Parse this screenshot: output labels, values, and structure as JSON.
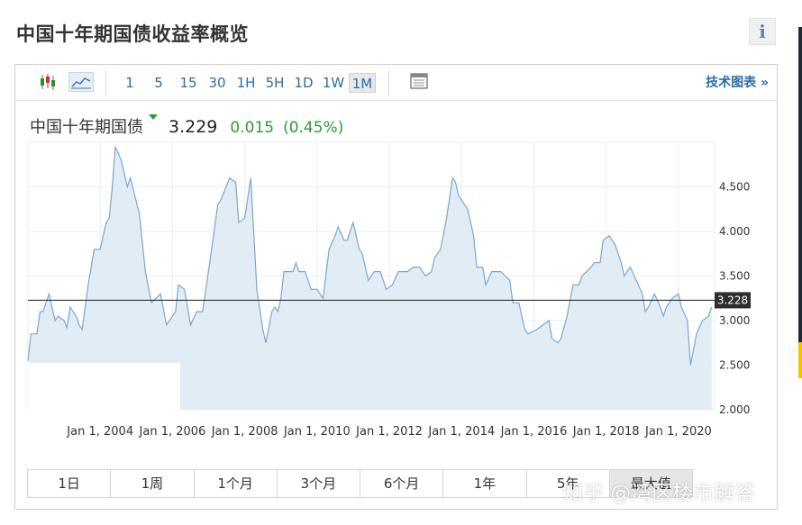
{
  "page": {
    "title": "中国十年期国债收益率概览",
    "info_icon": "i"
  },
  "toolbar": {
    "icons": [
      "candlestick-icon",
      "line-chart-icon",
      "table-icon"
    ],
    "intervals": [
      "1",
      "5",
      "15",
      "30",
      "1H",
      "5H",
      "1D",
      "1W",
      "1M"
    ],
    "active_interval": "1M",
    "tech_chart_label": "技术图表 »"
  },
  "quote": {
    "name": "中国十年期国债",
    "price": "3.229",
    "change": "0.015",
    "change_pct": "(0.45%)"
  },
  "colors": {
    "line": "#7aa7cf",
    "fill": "#e2ecf4",
    "positive": "#2e9a2e",
    "link": "#2c6cb0",
    "current_line": "#333333"
  },
  "chart_data": {
    "type": "area",
    "x_tick_labels": [
      "Jan 1, 2004",
      "Jan 1, 2006",
      "Jan 1, 2008",
      "Jan 1, 2010",
      "Jan 1, 2012",
      "Jan 1, 2014",
      "Jan 1, 2016",
      "Jan 1, 2018",
      "Jan 1, 2020"
    ],
    "y_tick_labels": [
      "2.000",
      "2.500",
      "3.000",
      "3.500",
      "4.000",
      "4.500"
    ],
    "ylim": [
      2.0,
      5.0
    ],
    "xlim": [
      "2002-01",
      "2020-12"
    ],
    "current_value_label": "3.228",
    "current_value": 3.228,
    "series": [
      {
        "dates": [
          "2002-01",
          "2002-02",
          "2002-04",
          "2002-05",
          "2002-06",
          "2002-08",
          "2002-10",
          "2002-11",
          "2003-01",
          "2003-02",
          "2003-03",
          "2003-05",
          "2003-06",
          "2003-07",
          "2003-09",
          "2003-11",
          "2004-01",
          "2004-03",
          "2004-04",
          "2004-05",
          "2004-06",
          "2004-08",
          "2004-10",
          "2004-11",
          "2005-02",
          "2005-04",
          "2005-06",
          "2005-09",
          "2005-11",
          "2006-02",
          "2006-03",
          "2006-05",
          "2006-07",
          "2006-09",
          "2006-11",
          "2007-02",
          "2007-04",
          "2007-05",
          "2007-08",
          "2007-10",
          "2007-11",
          "2008-01",
          "2008-03",
          "2008-05",
          "2008-07",
          "2008-08",
          "2008-10",
          "2008-11",
          "2008-12",
          "2009-01",
          "2009-02",
          "2009-05",
          "2009-06",
          "2009-07",
          "2009-09",
          "2009-11",
          "2010-01",
          "2010-03",
          "2010-05",
          "2010-07",
          "2010-08",
          "2010-10",
          "2010-11",
          "2011-01",
          "2011-03",
          "2011-04",
          "2011-06",
          "2011-08",
          "2011-09",
          "2011-10",
          "2011-12",
          "2012-02",
          "2012-04",
          "2012-07",
          "2012-09",
          "2012-11",
          "2013-01",
          "2013-03",
          "2013-04",
          "2013-06",
          "2013-08",
          "2013-10",
          "2013-11",
          "2013-12",
          "2014-02",
          "2014-03",
          "2014-05",
          "2014-06",
          "2014-08",
          "2014-09",
          "2014-11",
          "2015-01",
          "2015-02",
          "2015-05",
          "2015-06",
          "2015-08",
          "2015-10",
          "2015-11",
          "2016-02",
          "2016-04",
          "2016-06",
          "2016-07",
          "2016-09",
          "2016-10",
          "2016-12",
          "2017-02",
          "2017-04",
          "2017-05",
          "2017-08",
          "2017-09",
          "2017-11",
          "2017-12",
          "2018-02",
          "2018-04",
          "2018-06",
          "2018-07",
          "2018-09",
          "2018-11",
          "2019-01",
          "2019-02",
          "2019-03",
          "2019-05",
          "2019-07",
          "2019-08",
          "2019-09",
          "2019-11",
          "2020-01",
          "2020-02",
          "2020-04",
          "2020-05",
          "2020-07",
          "2020-09",
          "2020-11",
          "2020-12"
        ],
        "values": [
          2.55,
          2.85,
          2.85,
          3.1,
          3.1,
          3.3,
          3.0,
          3.05,
          3.0,
          2.92,
          3.15,
          3.05,
          2.95,
          2.9,
          3.4,
          3.8,
          3.8,
          4.1,
          4.15,
          4.5,
          4.95,
          4.8,
          4.5,
          4.6,
          4.2,
          3.55,
          3.2,
          3.3,
          2.95,
          3.1,
          3.4,
          3.35,
          2.95,
          3.1,
          3.1,
          3.8,
          4.3,
          4.35,
          4.6,
          4.55,
          4.1,
          4.15,
          4.6,
          3.35,
          2.9,
          2.75,
          3.1,
          3.15,
          3.1,
          3.25,
          3.55,
          3.55,
          3.65,
          3.55,
          3.55,
          3.35,
          3.35,
          3.25,
          3.8,
          3.95,
          4.05,
          3.9,
          3.9,
          4.1,
          3.8,
          3.75,
          3.45,
          3.55,
          3.55,
          3.55,
          3.35,
          3.4,
          3.55,
          3.55,
          3.6,
          3.6,
          3.5,
          3.55,
          3.7,
          3.8,
          4.15,
          4.6,
          4.55,
          4.4,
          4.3,
          4.25,
          3.95,
          3.6,
          3.6,
          3.4,
          3.55,
          3.55,
          3.55,
          3.45,
          3.2,
          3.2,
          2.9,
          2.85,
          2.9,
          2.95,
          3.0,
          2.8,
          2.75,
          2.8,
          3.05,
          3.4,
          3.4,
          3.5,
          3.6,
          3.65,
          3.65,
          3.9,
          3.95,
          3.85,
          3.65,
          3.5,
          3.6,
          3.45,
          3.3,
          3.1,
          3.15,
          3.3,
          3.15,
          3.05,
          3.15,
          3.25,
          3.3,
          3.15,
          3.0,
          2.5,
          2.85,
          3.0,
          3.05,
          3.15,
          3.2,
          3.23
        ]
      }
    ]
  },
  "ranges": [
    "1日",
    "1周",
    "1个月",
    "3个月",
    "6个月",
    "1年",
    "5年",
    "最大值"
  ],
  "active_range": "最大值",
  "watermark": "知乎 @湾区楼市解答"
}
